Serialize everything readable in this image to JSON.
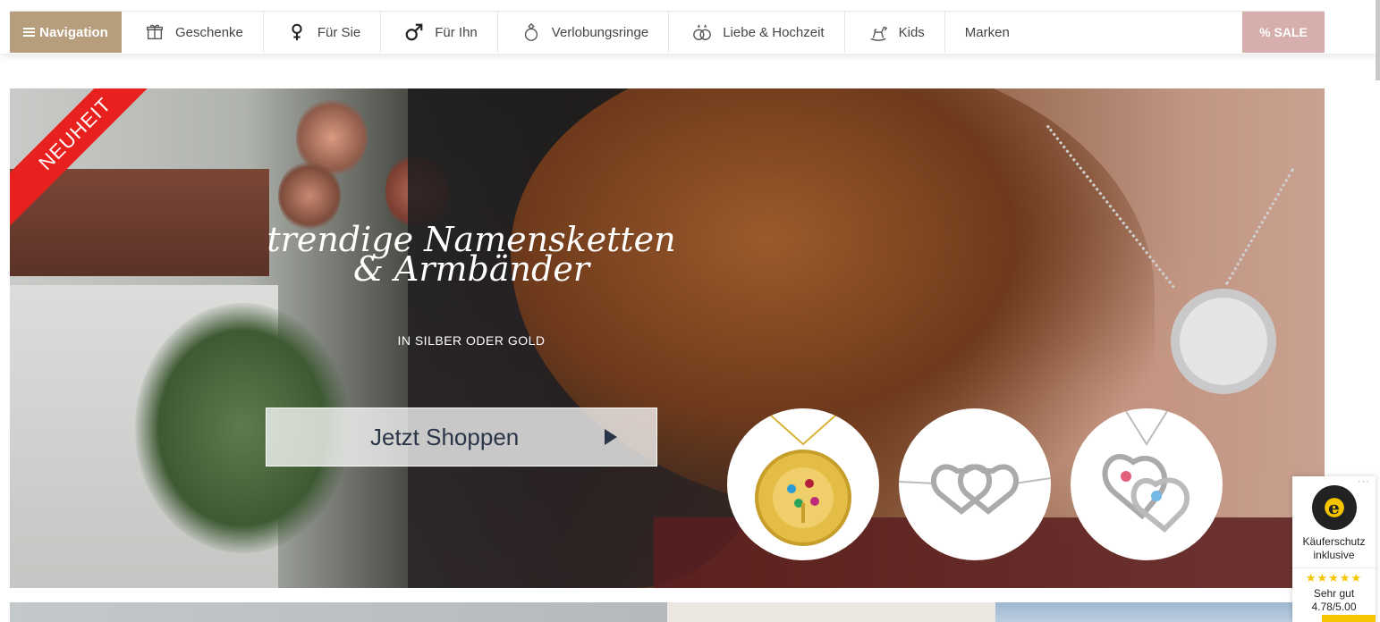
{
  "nav": {
    "navigation_label": "Navigation",
    "items": [
      {
        "label": "Geschenke",
        "icon": "gift-icon"
      },
      {
        "label": "Für Sie",
        "icon": "female-icon"
      },
      {
        "label": "Für Ihn",
        "icon": "male-icon"
      },
      {
        "label": "Verlobungsringe",
        "icon": "ring-icon"
      },
      {
        "label": "Liebe & Hochzeit",
        "icon": "rings-icon"
      },
      {
        "label": "Kids",
        "icon": "rocking-horse-icon"
      },
      {
        "label": "Marken",
        "icon": ""
      }
    ],
    "sale_label": "% SALE",
    "colors": {
      "navigation": "#b69d7c",
      "sale": "#d6afad"
    }
  },
  "hero": {
    "ribbon": "NEUHEIT",
    "title_line1": "trendige Namensketten",
    "title_line2": "& Armbänder",
    "subtitle": "IN SILBER ODER GOLD",
    "cta_label": "Jetzt Shoppen",
    "ribbon_color": "#e8201e"
  },
  "trusted_badge": {
    "label_line1": "Käuferschutz",
    "label_line2": "inklusive",
    "stars": "★★★★★",
    "rating_text": "Sehr gut",
    "rating_value": "4.78/5.00",
    "menu_dots": "···"
  }
}
